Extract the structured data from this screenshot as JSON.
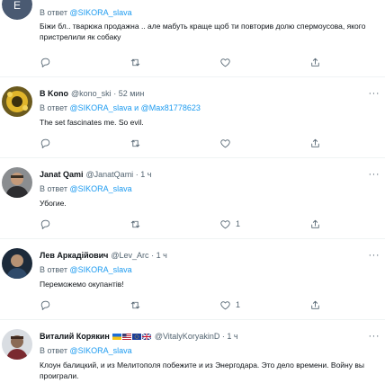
{
  "tweets": [
    {
      "reply_prefix": "В ответ",
      "reply_to": "@SIKORA_slava",
      "text": "Біжи бл.. тварюка продажна .. але мабуть краще щоб ти повторив долю спермоусова, якого пристрелили як собаку",
      "counts": {
        "reply": "",
        "retweet": "",
        "like": ""
      }
    },
    {
      "name": "В Kono",
      "handle": "@kono_ski",
      "time": "52 мин",
      "reply_prefix": "В ответ",
      "reply_to": "@SIKORA_slava и @Max81778623",
      "text": "The set fascinates me. So evil.",
      "counts": {
        "reply": "",
        "retweet": "",
        "like": ""
      }
    },
    {
      "name": "Janat Qami",
      "handle": "@JanatQami",
      "time": "1 ч",
      "reply_prefix": "В ответ",
      "reply_to": "@SIKORA_slava",
      "text": "Убогие.",
      "counts": {
        "reply": "",
        "retweet": "",
        "like": "1"
      }
    },
    {
      "name": "Лев Аркадійович",
      "handle": "@Lev_Arc",
      "time": "1 ч",
      "reply_prefix": "В ответ",
      "reply_to": "@SIKORA_slava",
      "text": "Переможемо окупантів!",
      "counts": {
        "reply": "",
        "retweet": "",
        "like": "1"
      }
    },
    {
      "name": "Виталий Корякин",
      "handle": "@VitalyKoryakinD",
      "time": "1 ч",
      "reply_prefix": "В ответ",
      "reply_to": "@SIKORA_slava",
      "text": "Клоун балицкий, и из Мелитополя побежите и из Энергодара. Это дело времени. Войну вы проиграли.",
      "counts": {
        "reply": "",
        "retweet": "",
        "like": ""
      }
    }
  ],
  "separator": "·",
  "more_label": "···",
  "colors": {
    "accent": "#1d9bf0",
    "muted": "#536471",
    "text": "#0f1419",
    "divider": "#eff3f4"
  },
  "icons": {
    "reply": "comment-icon",
    "retweet": "retweet-icon",
    "like": "heart-icon",
    "share": "share-icon",
    "more": "more-icon"
  }
}
